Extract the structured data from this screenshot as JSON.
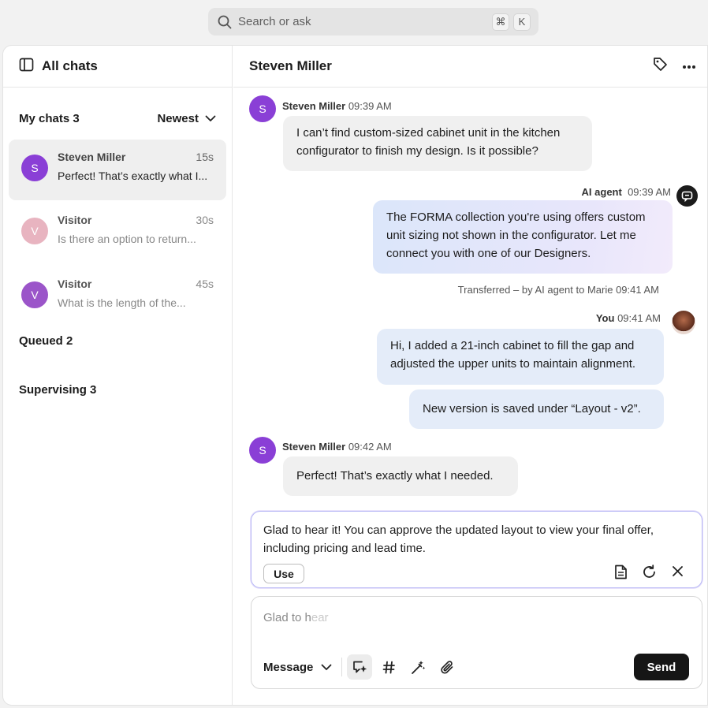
{
  "search": {
    "placeholder": "Search or ask",
    "shortcut_cmd": "⌘",
    "shortcut_key": "K"
  },
  "sidebar": {
    "title": "All chats",
    "my_chats_label": "My chats 3",
    "sort_label": "Newest",
    "chats": [
      {
        "initial": "S",
        "name": "Steven Miller",
        "time": "15s",
        "preview": "Perfect! That’s exactly what I...",
        "avatar_color": "#8a3fd6",
        "active": true
      },
      {
        "initial": "V",
        "name": "Visitor",
        "time": "30s",
        "preview": "Is there an option to return...",
        "avatar_color": "#e8b4c0",
        "active": false
      },
      {
        "initial": "V",
        "name": "Visitor",
        "time": "45s",
        "preview": "What is the length of the...",
        "avatar_color": "#9b55c9",
        "active": false
      }
    ],
    "queued_label": "Queued 2",
    "supervising_label": "Supervising 3"
  },
  "chat": {
    "title": "Steven Miller",
    "messages": [
      {
        "sender": "Steven Miller",
        "time": "09:39 AM",
        "initial": "S",
        "text_lines": [
          "I can’t find custom-sized cabinet unit in the kitchen",
          "configurator to finish my design. Is it possible?"
        ]
      },
      {
        "sender": "AI agent",
        "time": "09:39 AM",
        "text_lines": [
          "The FORMA collection you're using offers custom",
          "unit sizing not shown in the configurator. Let me",
          "connect you with one of our Designers."
        ]
      },
      {
        "system": "Transferred – by AI agent to Marie 09:41 AM"
      },
      {
        "sender": "You",
        "time": "09:41 AM",
        "text_lines": [
          "Hi, I added a 21-inch cabinet to fill the gap and",
          "adjusted the upper units to maintain alignment."
        ],
        "text2": "New version is saved under “Layout - v2”."
      },
      {
        "sender": "Steven Miller",
        "time": "09:42 AM",
        "initial": "S",
        "text": "Perfect! That’s exactly what I needed."
      }
    ]
  },
  "suggestion": {
    "text_line1": "Glad to hear it! You can approve the updated layout to view your final offer,",
    "text_line2": "including pricing and lead time.",
    "use_label": "Use"
  },
  "composer": {
    "typed": "Glad to h",
    "ghost": "ear",
    "type_label": "Message",
    "send_label": "Send"
  },
  "colors": {
    "accent_purple": "#8a3fd6",
    "send_bg": "#161616",
    "ai_bubble": "#dbe6fa",
    "you_bubble": "#e4ecf9"
  }
}
